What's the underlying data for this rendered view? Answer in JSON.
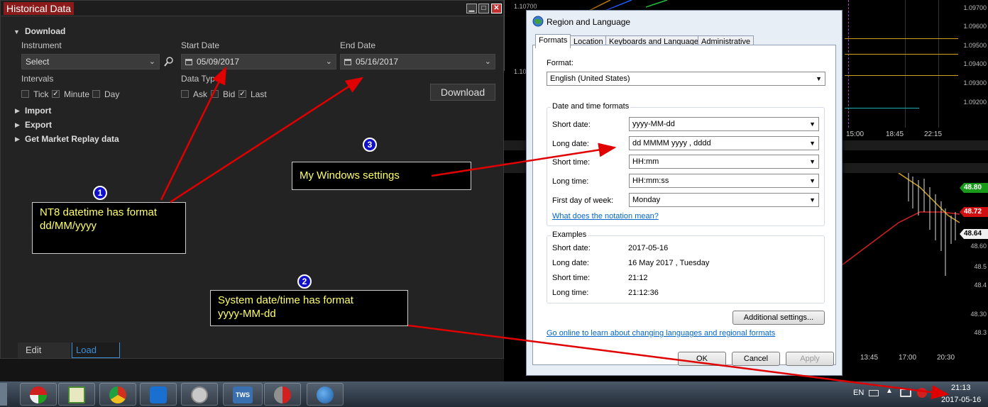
{
  "historical": {
    "title": "Historical Data",
    "download_label": "Download",
    "instrument_label": "Instrument",
    "instrument_value": "Select",
    "start_label": "Start Date",
    "start_value": "05/09/2017",
    "end_label": "End Date",
    "end_value": "05/16/2017",
    "intervals_label": "Intervals",
    "tick": "Tick",
    "minute": "Minute",
    "day": "Day",
    "datatype_label": "Data Type",
    "ask": "Ask",
    "bid": "Bid",
    "last": "Last",
    "download_button": "Download",
    "import": "Import",
    "export": "Export",
    "replay": "Get Market Replay data",
    "tab_edit": "Edit",
    "tab_load": "Load"
  },
  "annotations": {
    "n1": "1",
    "n2": "2",
    "n3": "3",
    "note1_line1": "NT8 datetime has format",
    "note1_line2": "dd/MM/yyyy",
    "note2_line1": "System date/time has format",
    "note2_line2": "yyyy-MM-dd",
    "note3": "My Windows settings"
  },
  "region": {
    "title": "Region and Language",
    "tabs": [
      "Formats",
      "Location",
      "Keyboards and Languages",
      "Administrative"
    ],
    "format_label": "Format:",
    "format_value": "English (United States)",
    "dt_group": "Date and time formats",
    "short_date_label": "Short date:",
    "short_date_value": "yyyy-MM-dd",
    "long_date_label": "Long date:",
    "long_date_value": "dd MMMM yyyy , dddd",
    "short_time_label": "Short time:",
    "short_time_value": "HH:mm",
    "long_time_label": "Long time:",
    "long_time_value": "HH:mm:ss",
    "first_day_label": "First day of week:",
    "first_day_value": "Monday",
    "notation_link": "What does the notation mean?",
    "examples_group": "Examples",
    "ex_short_date_label": "Short date:",
    "ex_short_date": "2017-05-16",
    "ex_long_date_label": "Long date:",
    "ex_long_date": "16 May 2017 , Tuesday",
    "ex_short_time_label": "Short time:",
    "ex_short_time": "21:12",
    "ex_long_time_label": "Long time:",
    "ex_long_time": "21:12:36",
    "additional_button": "Additional settings...",
    "online_link": "Go online to learn about changing languages and regional formats",
    "ok": "OK",
    "cancel": "Cancel",
    "apply": "Apply"
  },
  "chart_bg": {
    "prices_top": [
      "1.10700",
      "1.10",
      "1.09700",
      "1.09600",
      "1.09500",
      "1.09400",
      "1.09300",
      "1.09200"
    ],
    "times_top": [
      "15:00",
      "18:45",
      "22:15"
    ],
    "tags": [
      "48.80",
      "48.72",
      "48.64"
    ],
    "prices_bottom": [
      "48.60",
      "48.5",
      "48.4",
      "48.30",
      "48.3"
    ],
    "times_bottom": [
      "13:45",
      "17:00",
      "20:30"
    ]
  },
  "taskbar": {
    "lang": "EN",
    "time": "21:13",
    "date": "2017-05-16",
    "tws": "TWS"
  }
}
